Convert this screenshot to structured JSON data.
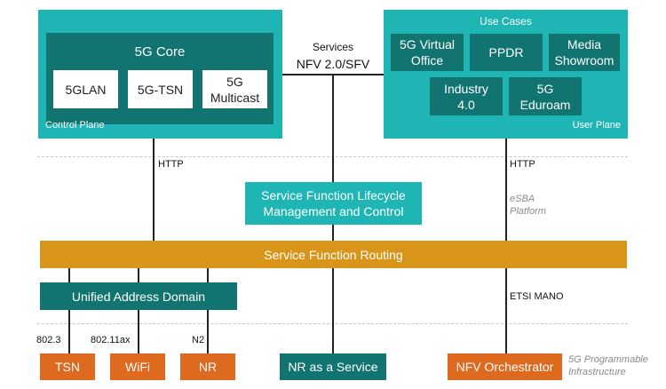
{
  "control_plane": {
    "label": "Control Plane",
    "core": {
      "title": "5G Core",
      "items": [
        "5GLAN",
        "5G-TSN",
        "5G\nMulticast"
      ]
    }
  },
  "user_plane": {
    "label": "User Plane",
    "title": "Use Cases",
    "items": [
      "5G Virtual\nOffice",
      "PPDR",
      "Media\nShowroom",
      "Industry\n4.0",
      "5G\nEduroam"
    ]
  },
  "services_label": "Services",
  "nfv_label": "NFV 2.0/SFV",
  "http_left": "HTTP",
  "http_right": "HTTP",
  "lifecycle": "Service Function Lifecycle\nManagement and Control",
  "esba": "eSBA\nPlatform",
  "routing": "Service Function Routing",
  "address_domain": "Unified Address Domain",
  "etsi": "ETSI MANO",
  "interfaces": [
    "802.3",
    "802.11ax",
    "N2"
  ],
  "bottom": {
    "tsn": "TSN",
    "wifi": "WiFi",
    "nr": "NR",
    "nraas": "NR as a Service",
    "orchestrator": "NFV Orchestrator"
  },
  "programmable": "5G Programmable\nInfrastructure"
}
